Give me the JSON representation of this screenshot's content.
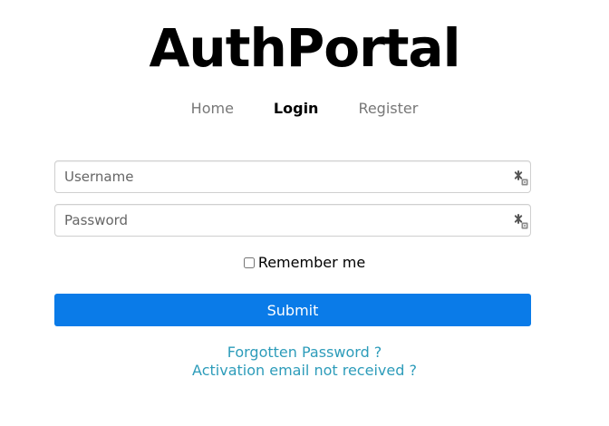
{
  "app": {
    "title": "AuthPortal"
  },
  "nav": {
    "items": [
      {
        "label": "Home",
        "active": false
      },
      {
        "label": "Login",
        "active": true
      },
      {
        "label": "Register",
        "active": false
      }
    ]
  },
  "form": {
    "username": {
      "placeholder": "Username",
      "value": ""
    },
    "password": {
      "placeholder": "Password",
      "value": ""
    },
    "remember": {
      "label": "Remember me",
      "checked": false
    },
    "submit_label": "Submit",
    "links": {
      "forgot_password": "Forgotten Password ?",
      "activation_email": "Activation email not received ?"
    }
  },
  "icons": {
    "username_field_icon": "password-key-icon",
    "password_field_icon": "password-key-icon"
  },
  "colors": {
    "primary": "#0a7be8",
    "link": "#2d9cba",
    "nav_inactive": "#777777",
    "nav_active": "#000000"
  }
}
